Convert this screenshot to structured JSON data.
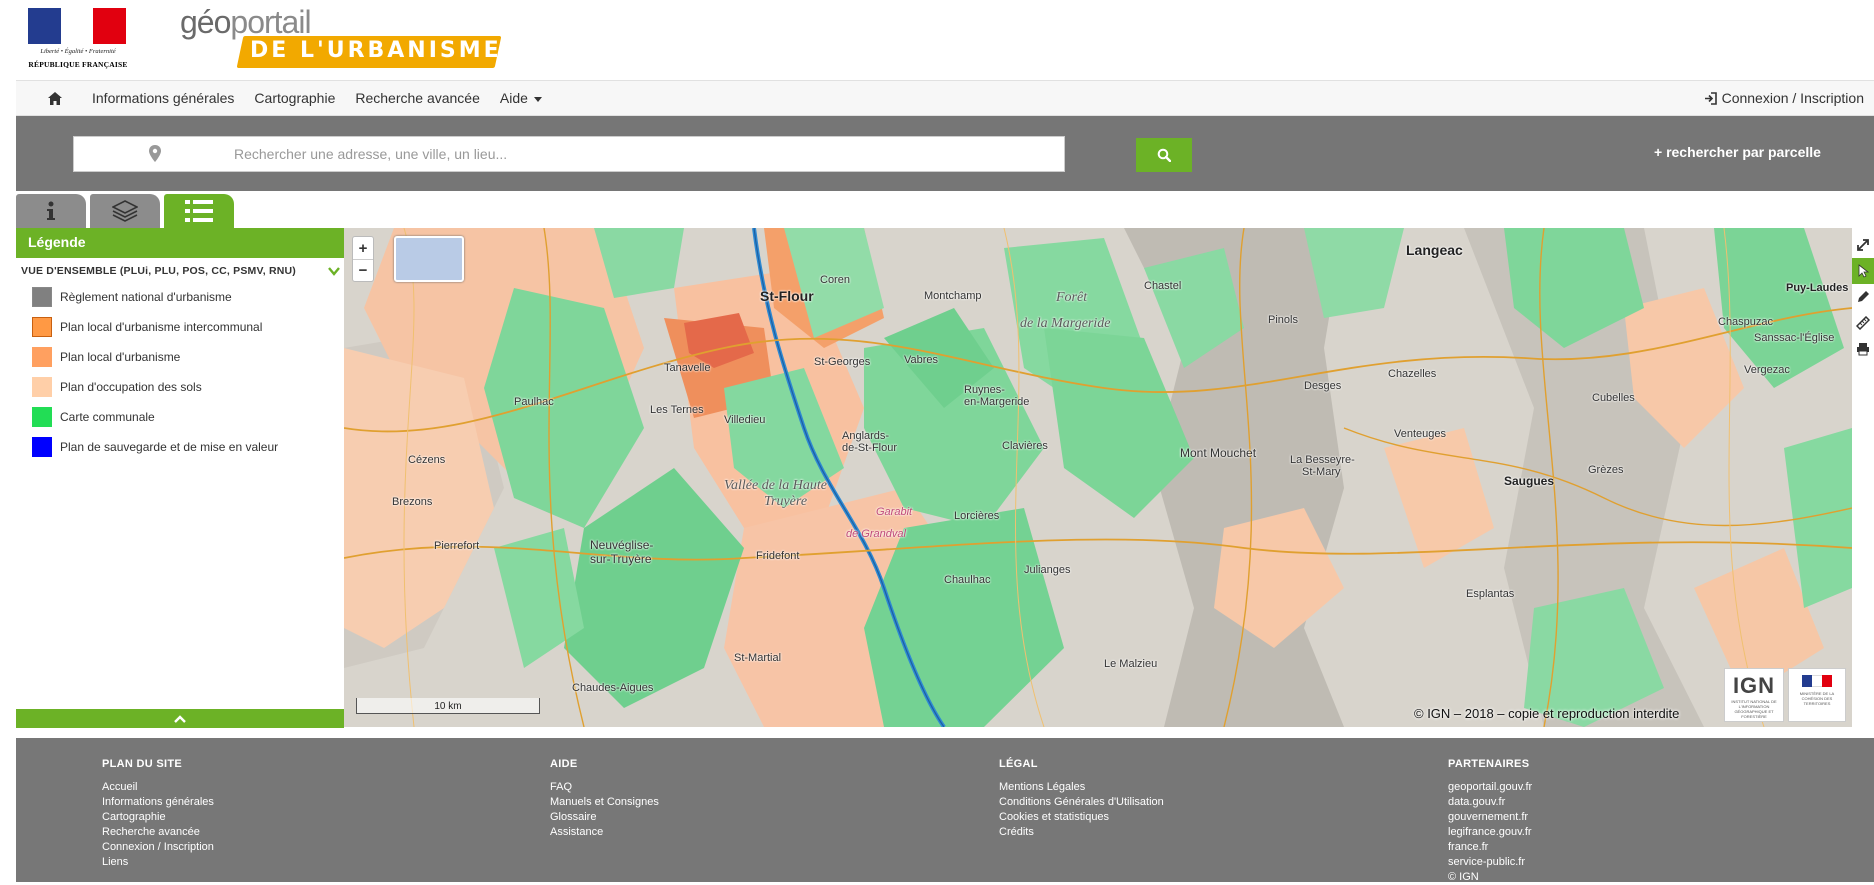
{
  "header": {
    "rf_motto": "Liberté • Égalité • Fraternité",
    "rf_name": "RÉPUBLIQUE FRANÇAISE",
    "gp_geo": "géo",
    "gp_portail": "portail",
    "gp_urba": "DE L'URBANISME"
  },
  "nav": {
    "home_icon": "home-icon",
    "items": [
      {
        "label": "Informations générales"
      },
      {
        "label": "Cartographie"
      },
      {
        "label": "Recherche avancée"
      },
      {
        "label": "Aide",
        "dropdown": true
      }
    ],
    "login": "Connexion / Inscription"
  },
  "search": {
    "placeholder": "Rechercher une adresse, une ville, un lieu...",
    "value": "",
    "button_icon": "search-icon",
    "parcel_link": "+ rechercher par parcelle"
  },
  "tabs": [
    {
      "icon": "info-icon",
      "active": false
    },
    {
      "icon": "layers-icon",
      "active": false
    },
    {
      "icon": "list-icon",
      "active": true
    }
  ],
  "legend": {
    "title": "Légende",
    "section": "VUE D'ENSEMBLE (PLUi, PLU, POS, CC, PSMV, RNU)",
    "items": [
      {
        "label": "Règlement national d'urbanisme",
        "color": "#808080"
      },
      {
        "label": "Plan local d'urbanisme intercommunal",
        "color": "#ff9944"
      },
      {
        "label": "Plan local d'urbanisme",
        "color": "#ffa060"
      },
      {
        "label": "Plan d'occupation des sols",
        "color": "#ffcfa8"
      },
      {
        "label": "Carte communale",
        "color": "#22dd55"
      },
      {
        "label": "Plan de sauvegarde et de mise en valeur",
        "color": "#0000ff"
      }
    ]
  },
  "map": {
    "zoom_in": "+",
    "zoom_out": "−",
    "scale": "10 km",
    "copyright": "© IGN – 2018 – copie et reproduction interdite",
    "ign": "IGN",
    "ign_sub": "INSTITUT NATIONAL DE L'INFORMATION GÉOGRAPHIQUE ET FORESTIÈRE",
    "ministry_sub": "MINISTÈRE DE LA COHÉSION DES TERRITOIRES",
    "labels": {
      "st_flour": "St-Flour",
      "langeac": "Langeac",
      "saugues": "Saugues",
      "foret": "Forêt",
      "margeride": "de la Margeride",
      "vallee": "Vallée de la Haute",
      "truyere": "Truyère",
      "neuveglise": "Neuvéglise-",
      "sur_truyere": "sur-Truyère",
      "puy_laudes": "Puy-Laudes",
      "pierrefort": "Pierrefort",
      "chaudes_aigues": "Chaudes-Aigues",
      "tanavelle": "Tanavelle",
      "villedieu": "Villedieu",
      "les_ternes": "Les Ternes",
      "paulhac": "Paulhac",
      "coren": "Coren",
      "vabres": "Vabres",
      "ruynes": "Ruynes-",
      "ruynes2": "en-Margeride",
      "clavieres": "Clavières",
      "anglards": "Anglards-",
      "anglards2": "de-St-Flour",
      "mont_mouchet": "Mont Mouchet",
      "venteuges": "Venteuges",
      "pinols": "Pinols",
      "desges": "Desges",
      "chazelles": "Chazelles",
      "cezens": "Cézens",
      "brezons": "Brezons",
      "fridefont": "Fridefont",
      "st_martial": "St-Martial",
      "lorcieres": "Lorcières",
      "garabit": "Garabit",
      "grandval": "de Grandval",
      "chaulhac": "Chaulhac",
      "julianges": "Julianges",
      "esplantas": "Esplantas",
      "vergezac": "Vergezac",
      "chaspuzac": "Chaspuzac",
      "sanssac": "Sanssac-l'Église",
      "cubelles": "Cubelles",
      "grezes": "Grèzes",
      "chastel": "Chastel",
      "montchamp": "Montchamp",
      "st_georges": "St-Georges",
      "la_besseyre": "La Besseyre-",
      "st_mary": "St-Mary",
      "le_malzieu": "Le Malzieu"
    }
  },
  "toolbar": [
    "fullscreen-icon",
    "pointer-icon",
    "pencil-icon",
    "ruler-icon",
    "print-icon"
  ],
  "footer": {
    "cols": [
      {
        "title": "PLAN DU SITE",
        "links": [
          "Accueil",
          "Informations générales",
          "Cartographie",
          "Recherche avancée",
          "Connexion / Inscription",
          "Liens"
        ]
      },
      {
        "title": "AIDE",
        "links": [
          "FAQ",
          "Manuels et Consignes",
          "Glossaire",
          "Assistance"
        ]
      },
      {
        "title": "LÉGAL",
        "links": [
          "Mentions Légales",
          "Conditions Générales d'Utilisation",
          "Cookies et statistiques",
          "Crédits"
        ]
      },
      {
        "title": "PARTENAIRES",
        "links": [
          "geoportail.gouv.fr",
          "data.gouv.fr",
          "gouvernement.fr",
          "legifrance.gouv.fr",
          "france.fr",
          "service-public.fr",
          "© IGN"
        ]
      }
    ]
  }
}
